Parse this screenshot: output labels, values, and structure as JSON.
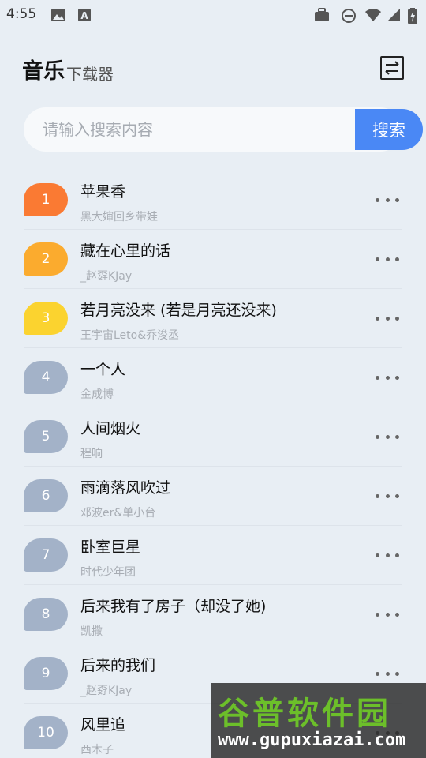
{
  "status_bar": {
    "time": "4:55",
    "left_icons": [
      "image-icon",
      "a-badge-icon"
    ],
    "right_icons": [
      "briefcase-icon",
      "do-not-disturb-icon",
      "wifi-icon",
      "signal-icon",
      "battery-charging-icon"
    ]
  },
  "header": {
    "title": "音乐",
    "subtitle": "下载器",
    "switch_icon": "switch-icon"
  },
  "search": {
    "placeholder": "请输入搜索内容",
    "value": "",
    "button_label": "搜索"
  },
  "colors": {
    "accent": "#4a88f5",
    "rank1": "#fa7a33",
    "rank2": "#fbab2e",
    "rank3": "#fbd32f",
    "rank_default": "#a3b2c8",
    "background": "#e8eef4"
  },
  "songs": [
    {
      "rank": "1",
      "title": "苹果香",
      "artist": "黑大婶回乡带娃"
    },
    {
      "rank": "2",
      "title": "藏在心里的话",
      "artist": "_赵孬KJay"
    },
    {
      "rank": "3",
      "title": "若月亮没来 (若是月亮还没来)",
      "artist": "王宇宙Leto&乔浚丞"
    },
    {
      "rank": "4",
      "title": "一个人",
      "artist": "金成博"
    },
    {
      "rank": "5",
      "title": "人间烟火",
      "artist": "程响"
    },
    {
      "rank": "6",
      "title": "雨滴落风吹过",
      "artist": "邓波er&单小台"
    },
    {
      "rank": "7",
      "title": "卧室巨星",
      "artist": "时代少年团"
    },
    {
      "rank": "8",
      "title": "后来我有了房子（却没了她)",
      "artist": "凯撒"
    },
    {
      "rank": "9",
      "title": "后来的我们",
      "artist": "_赵孬KJay"
    },
    {
      "rank": "10",
      "title": "风里追",
      "artist": "西木子"
    }
  ],
  "watermark": {
    "cn": "谷普软件园",
    "en": "www.gupuxiazai.com"
  }
}
